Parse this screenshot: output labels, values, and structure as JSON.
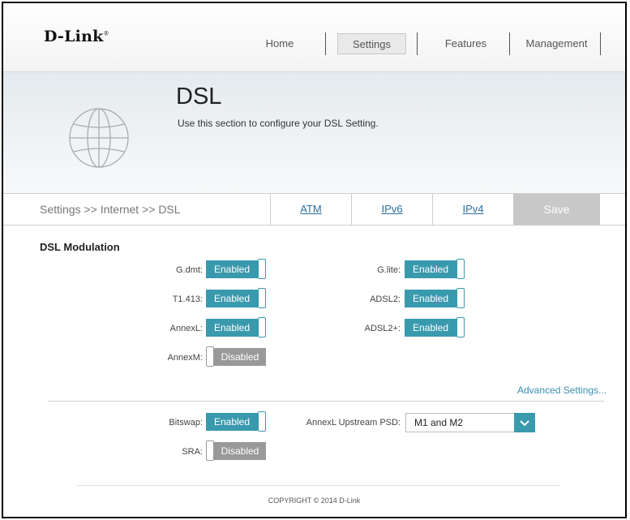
{
  "header": {
    "logo": "D-Link",
    "nav": [
      "Home",
      "Settings",
      "Features",
      "Management"
    ],
    "active_nav": "Settings"
  },
  "banner": {
    "title": "DSL",
    "description": "Use this section to configure your DSL Setting.",
    "icon": "globe-icon"
  },
  "tabbar": {
    "breadcrumb": "Settings >> Internet >> DSL",
    "tabs": [
      "ATM",
      "IPv6",
      "IPv4"
    ],
    "save_label": "Save"
  },
  "modulation": {
    "title": "DSL Modulation",
    "gdmt": {
      "label": "G.dmt:",
      "state": "Enabled"
    },
    "glite": {
      "label": "G.lite:",
      "state": "Enabled"
    },
    "t1413": {
      "label": "T1.413:",
      "state": "Enabled"
    },
    "adsl2": {
      "label": "ADSL2:",
      "state": "Enabled"
    },
    "annexl": {
      "label": "AnnexL:",
      "state": "Enabled"
    },
    "adsl2plus": {
      "label": "ADSL2+:",
      "state": "Enabled"
    },
    "annexm": {
      "label": "AnnexM:",
      "state": "Disabled"
    }
  },
  "advanced_link": "Advanced Settings...",
  "advanced": {
    "bitswap": {
      "label": "Bitswap:",
      "state": "Enabled"
    },
    "sra": {
      "label": "SRA:",
      "state": "Disabled"
    },
    "annexl_psd": {
      "label": "AnnexL Upstream PSD:",
      "value": "M1 and M2"
    }
  },
  "footer": {
    "copyright": "COPYRIGHT © 2014 D-Link"
  },
  "colors": {
    "accent": "#3a9aad",
    "disabled": "#999999",
    "link": "#2b6e9c"
  }
}
